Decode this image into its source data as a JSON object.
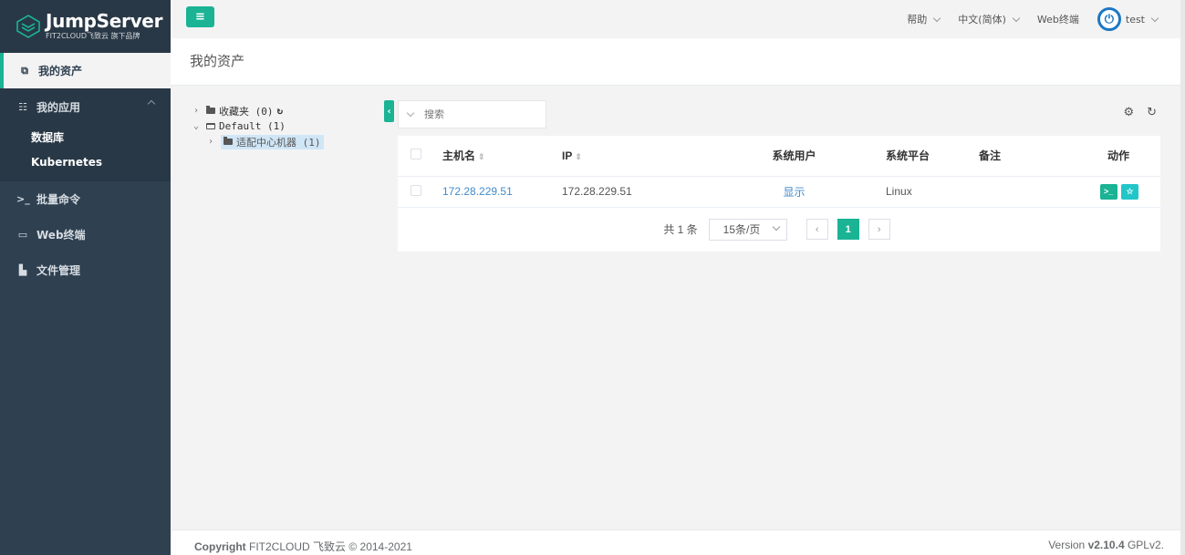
{
  "brand": {
    "title": "JumpServer",
    "subtitle": "FIT2CLOUD飞致云 旗下品牌"
  },
  "sidebar": {
    "items": [
      {
        "label": "我的资产",
        "icon": "assets-icon"
      },
      {
        "label": "我的应用",
        "icon": "grid-icon"
      },
      {
        "label": "批量命令",
        "icon": "terminal-prompt-icon"
      },
      {
        "label": "Web终端",
        "icon": "window-icon"
      },
      {
        "label": "文件管理",
        "icon": "file-icon"
      }
    ],
    "app_sub": [
      "数据库",
      "Kubernetes"
    ]
  },
  "topbar": {
    "menu_icon": "≡",
    "help": "帮助",
    "language": "中文(简体)",
    "web_terminal": "Web终端",
    "user": "test"
  },
  "page": {
    "title": "我的资产"
  },
  "tree": {
    "favorites": "收藏夹 (0)",
    "default": "Default (1)",
    "child": "适配中心机器 (1)"
  },
  "search": {
    "placeholder": "搜索"
  },
  "table": {
    "headers": {
      "hostname": "主机名",
      "ip": "IP",
      "system_user": "系统用户",
      "platform": "系统平台",
      "comment": "备注",
      "actions": "动作"
    },
    "rows": [
      {
        "hostname": "172.28.229.51",
        "ip": "172.28.229.51",
        "system_user": "显示",
        "platform": "Linux",
        "comment": ""
      }
    ]
  },
  "pagination": {
    "total": "共 1 条",
    "page_size": "15条/页",
    "current_page": "1"
  },
  "footer": {
    "copyright_label": "Copyright",
    "copyright_text": "FIT2CLOUD 飞致云 © 2014-2021",
    "version_label": "Version",
    "version": "v2.10.4",
    "license": "GPLv2."
  },
  "colors": {
    "accent": "#1ab394",
    "sidebar": "#2f4050",
    "link": "#428bca"
  }
}
